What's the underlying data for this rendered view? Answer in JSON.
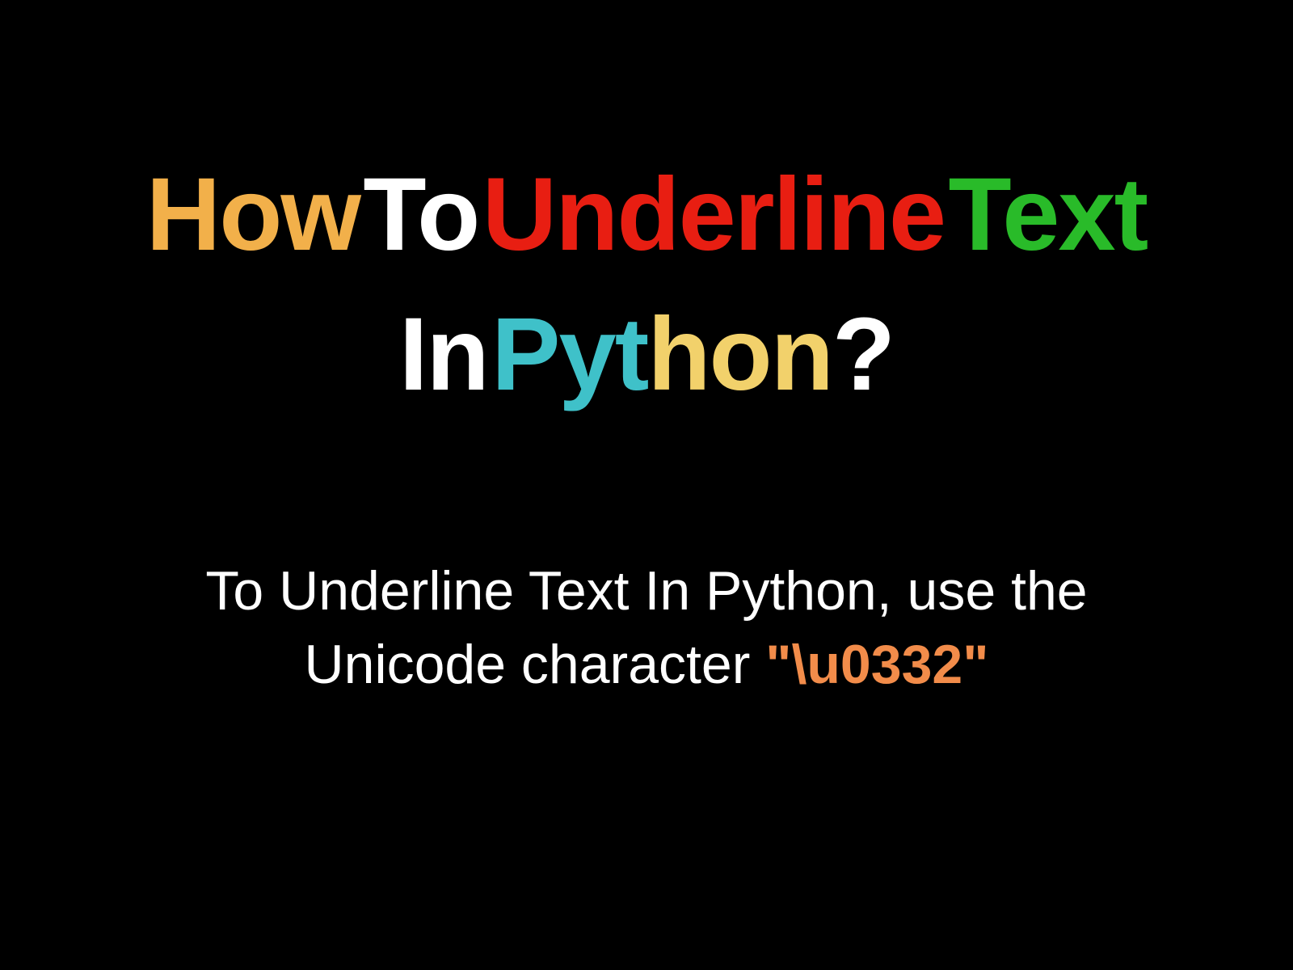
{
  "title": {
    "word1": "How",
    "word2": "To",
    "word3": "Underline",
    "word4": "Text",
    "word5": "In",
    "word6a": "Pyt",
    "word6b": "hon",
    "word7": "?"
  },
  "subtitle": {
    "line1": "To Underline Text In Python, use the",
    "line2_prefix": "Unicode character ",
    "code": "\"\\u0332\""
  }
}
